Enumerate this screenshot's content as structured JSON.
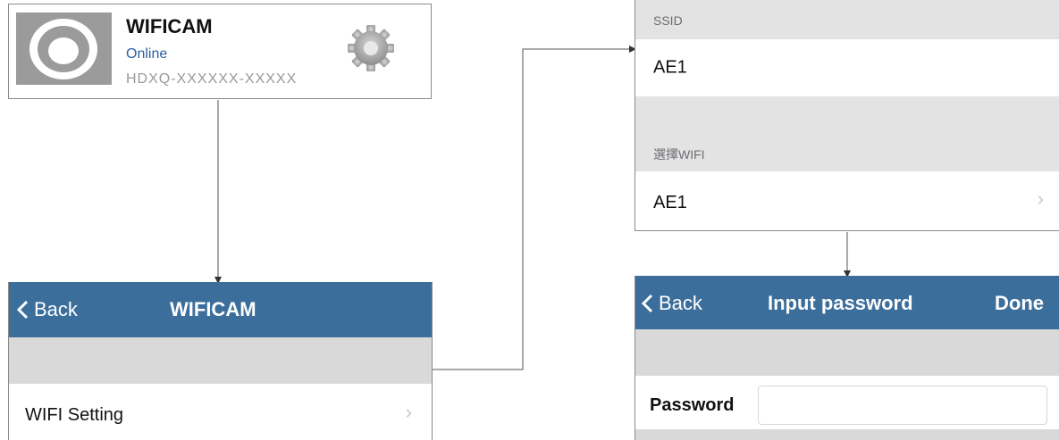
{
  "device_card": {
    "name": "WIFICAM",
    "status": "Online",
    "uid": "HDXQ-XXXXXX-XXXXX",
    "thumbnail_icon": "camera-lens-icon",
    "settings_icon": "gear-icon"
  },
  "screen_device": {
    "back_label": "Back",
    "title": "WIFICAM",
    "row_label": "WIFI Setting"
  },
  "screen_wifi": {
    "ssid_header": "SSID",
    "ssid_value": "AE1",
    "select_header": "選擇WIFI",
    "selected_wifi": "AE1"
  },
  "screen_password": {
    "back_label": "Back",
    "title": "Input password",
    "done_label": "Done",
    "password_label": "Password",
    "password_value": ""
  },
  "colors": {
    "navbar": "#3c6e9b",
    "status_text": "#2b5fa2",
    "section_gray": "#d9d9da"
  }
}
